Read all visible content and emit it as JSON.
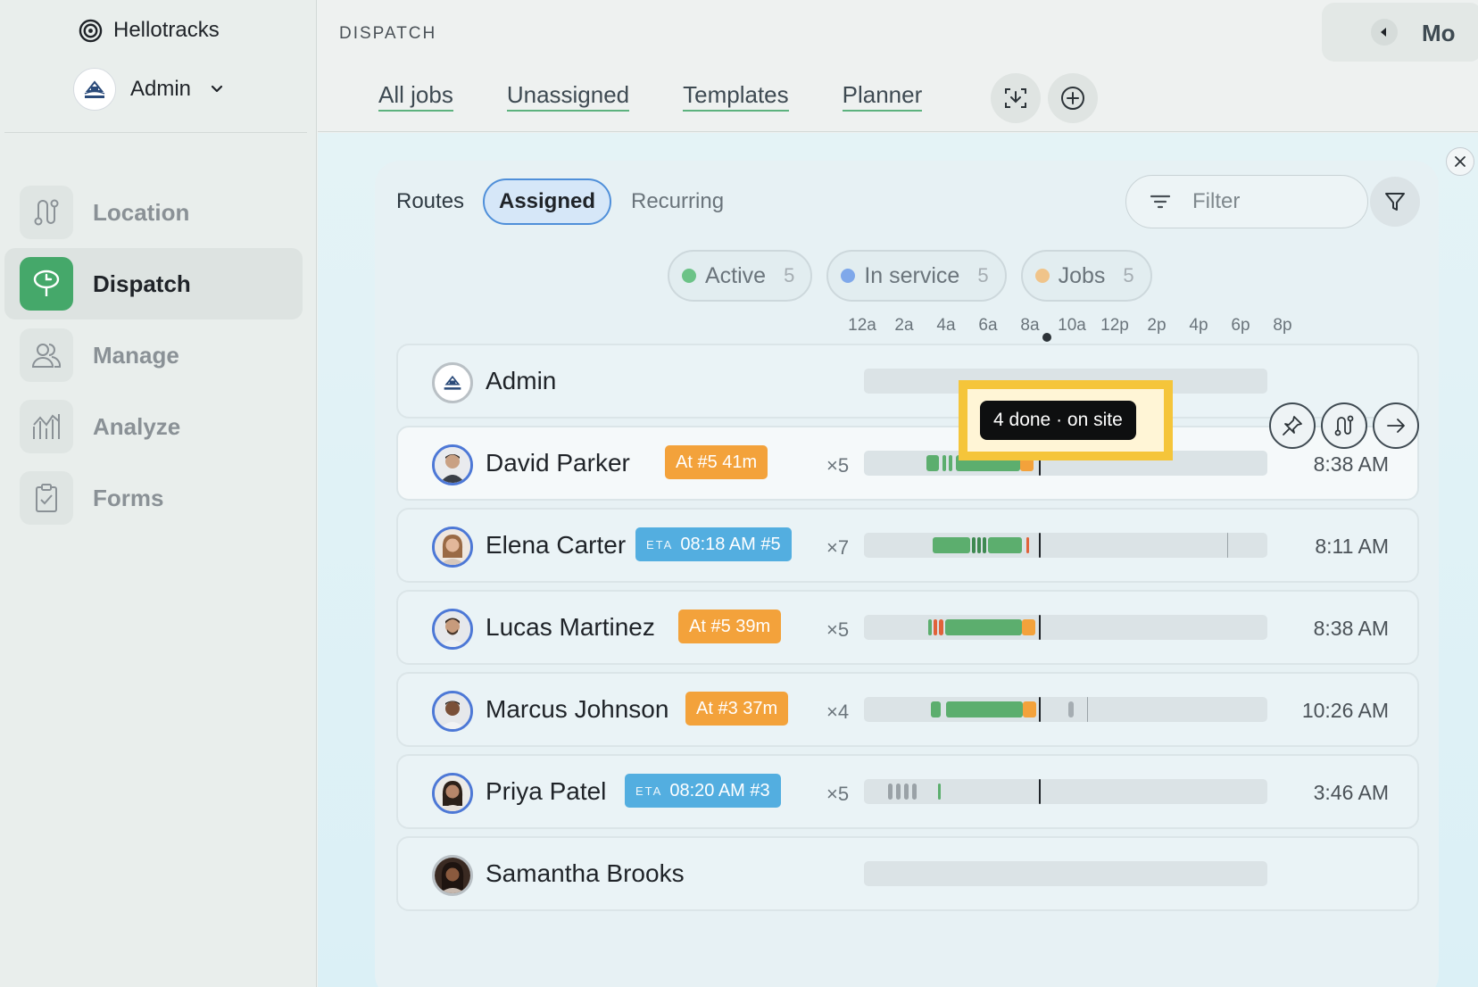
{
  "app": {
    "name": "Hellotracks"
  },
  "account": {
    "name": "Admin"
  },
  "sidebar": {
    "items": [
      {
        "label": "Location",
        "icon": "route-icon"
      },
      {
        "label": "Dispatch",
        "icon": "dispatch-icon",
        "active": true
      },
      {
        "label": "Manage",
        "icon": "users-icon"
      },
      {
        "label": "Analyze",
        "icon": "chart-icon"
      },
      {
        "label": "Forms",
        "icon": "clipboard-icon"
      }
    ]
  },
  "header": {
    "title": "DISPATCH",
    "tabs": [
      "All jobs",
      "Unassigned",
      "Templates",
      "Planner"
    ],
    "side_panel_label": "Mo"
  },
  "toolbar": {
    "segments": [
      "Routes",
      "Assigned",
      "Recurring"
    ],
    "filter_placeholder": "Filter"
  },
  "status_chips": [
    {
      "label": "Active",
      "count": "5",
      "color": "#6cc387"
    },
    {
      "label": "In service",
      "count": "5",
      "color": "#7fa8ea"
    },
    {
      "label": "Jobs",
      "count": "5",
      "color": "#f0c48a"
    }
  ],
  "timeline": {
    "labels": [
      "12a",
      "2a",
      "4a",
      "6a",
      "8a",
      "10a",
      "12p",
      "2p",
      "4p",
      "6p",
      "8p"
    ]
  },
  "tooltip": {
    "text": "4 done · on site"
  },
  "rows": [
    {
      "name": "Admin",
      "badge": "",
      "eta": "",
      "count": "",
      "time": ""
    },
    {
      "name": "David Parker",
      "badge": "At #5 41m",
      "eta": "",
      "count": "×5",
      "time": "8:38 AM"
    },
    {
      "name": "Elena Carter",
      "badge": "08:18 AM #5",
      "eta": "ETA",
      "count": "×7",
      "time": "8:11 AM"
    },
    {
      "name": "Lucas Martinez",
      "badge": "At #5 39m",
      "eta": "",
      "count": "×5",
      "time": "8:38 AM"
    },
    {
      "name": "Marcus Johnson",
      "badge": "At #3 37m",
      "eta": "",
      "count": "×4",
      "time": "10:26 AM"
    },
    {
      "name": "Priya Patel",
      "badge": "08:20 AM #3",
      "eta": "ETA",
      "count": "×5",
      "time": "3:46 AM"
    },
    {
      "name": "Samantha Brooks",
      "badge": "",
      "eta": "",
      "count": "",
      "time": ""
    }
  ],
  "colors": {
    "accent_green": "#45a86a",
    "job_done": "#5cae6e",
    "on_site": "#f3a23b",
    "late": "#e0623a",
    "eta_badge": "#53aee0",
    "highlight": "#f5c53a"
  }
}
